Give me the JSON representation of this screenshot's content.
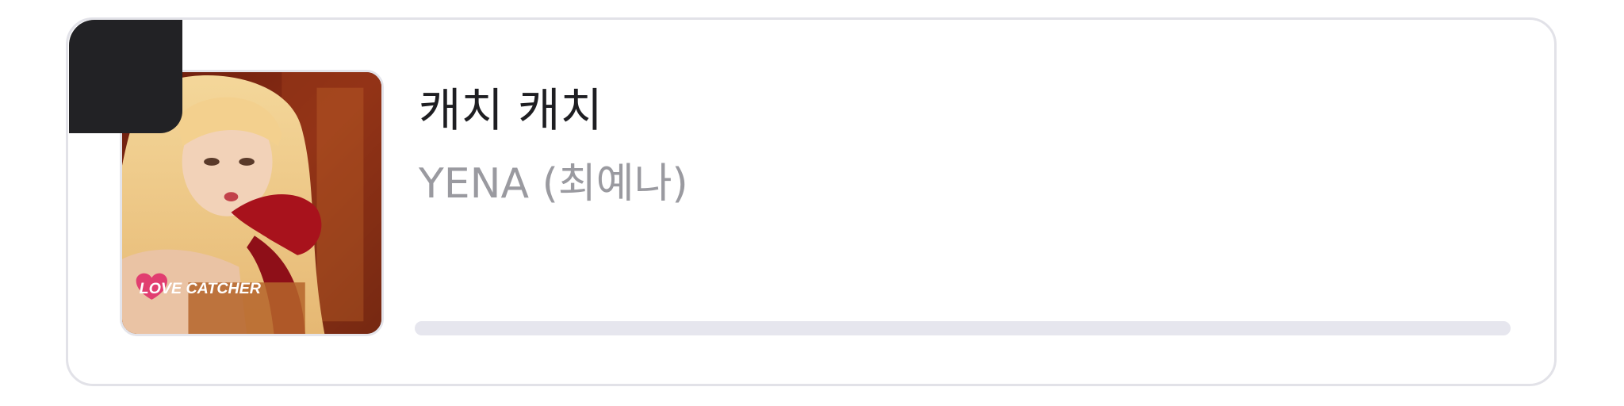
{
  "now_playing": {
    "title": "캐치 캐치",
    "artist": "YENA (최예나)",
    "album_art_logo": "LOVE CATCHER",
    "progress": 0.0
  },
  "colors": {
    "card_border": "#e2e2e8",
    "corner_block": "#222225",
    "title_text": "#1e1e22",
    "artist_text": "#9a9aa0",
    "progress_track": "#e6e6ee"
  }
}
